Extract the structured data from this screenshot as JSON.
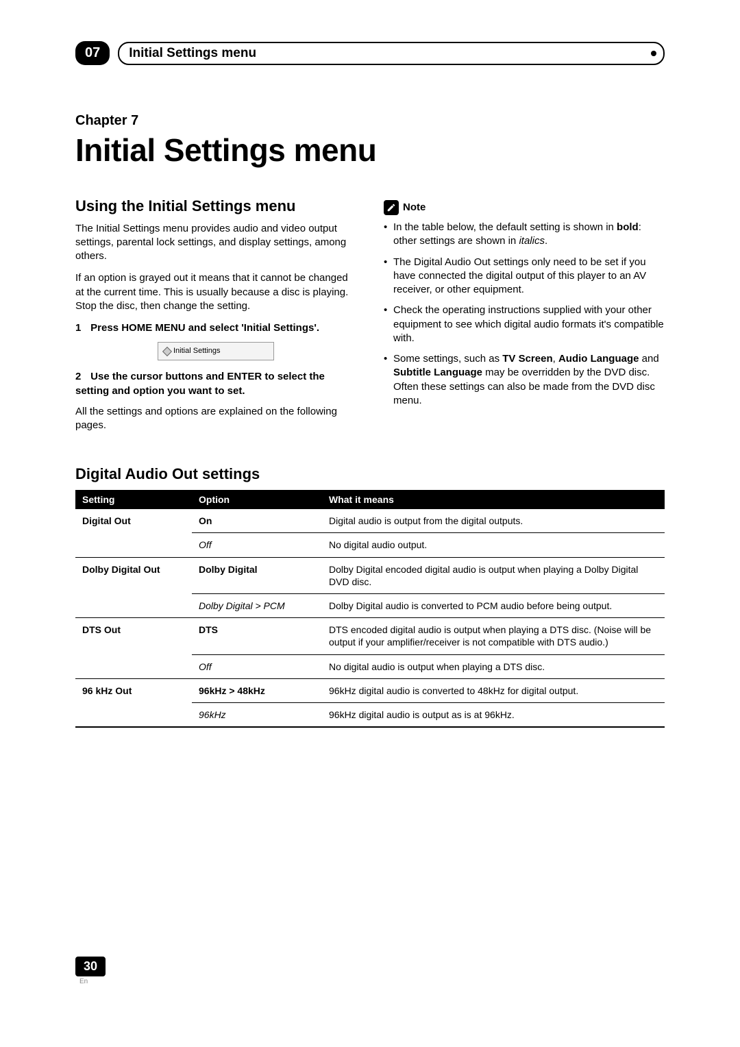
{
  "header": {
    "chapter_number_badge": "07",
    "section_title": "Initial Settings menu"
  },
  "chapter": {
    "label": "Chapter 7",
    "title": "Initial Settings menu"
  },
  "left": {
    "heading": "Using the Initial Settings menu",
    "p1": "The Initial Settings menu provides audio and video output settings, parental lock settings, and display settings, among others.",
    "p2": "If an option is grayed out it means that it cannot be changed at the current time. This is usually because a disc is playing. Stop the disc, then change the setting.",
    "step1_num": "1",
    "step1": "Press HOME MENU and select 'Initial Settings'.",
    "screenshot_label": "Initial Settings",
    "step2_num": "2",
    "step2": "Use the cursor buttons and ENTER to select the setting and option you want to set.",
    "p3": "All the settings and options are explained on the following pages."
  },
  "right": {
    "note_label": "Note",
    "bullets": {
      "b1_pre": "In the table below, the default setting is shown in ",
      "b1_bold": "bold",
      "b1_mid": ": other settings are shown in ",
      "b1_it": "italics",
      "b1_post": ".",
      "b2": "The Digital Audio Out settings only need to be set if you have connected the digital output of this player to an AV receiver, or other equipment.",
      "b3": "Check the operating instructions supplied with your other equipment to see which digital audio formats it's compatible with.",
      "b4_pre": "Some settings, such as ",
      "b4_b1": "TV Screen",
      "b4_sep1": ", ",
      "b4_b2": "Audio Language",
      "b4_sep2": " and ",
      "b4_b3": "Subtitle Language",
      "b4_post": " may be overridden by the DVD disc. Often these settings can also be made from the DVD disc menu."
    }
  },
  "table_section_heading": "Digital Audio Out settings",
  "table": {
    "headers": {
      "c1": "Setting",
      "c2": "Option",
      "c3": "What it means"
    },
    "rows": [
      {
        "setting": "Digital Out",
        "option": "On",
        "option_style": "default",
        "meaning": "Digital audio is output from the digital outputs."
      },
      {
        "setting": "",
        "option": "Off",
        "option_style": "italic",
        "meaning": "No digital audio output."
      },
      {
        "setting": "Dolby Digital Out",
        "option": "Dolby Digital",
        "option_style": "default",
        "meaning": "Dolby Digital encoded digital audio is output when playing a Dolby Digital DVD disc."
      },
      {
        "setting": "",
        "option": "Dolby Digital > PCM",
        "option_style": "italic",
        "meaning": "Dolby Digital audio is converted to PCM audio before being output."
      },
      {
        "setting": "DTS Out",
        "option": "DTS",
        "option_style": "default",
        "meaning": "DTS encoded digital audio is output when playing a DTS disc. (Noise will be output if your amplifier/receiver is not compatible with DTS audio.)"
      },
      {
        "setting": "",
        "option": "Off",
        "option_style": "italic",
        "meaning": "No digital audio is output when playing a DTS disc."
      },
      {
        "setting": "96 kHz Out",
        "option": "96kHz > 48kHz",
        "option_style": "default",
        "meaning": "96kHz digital audio is converted to 48kHz for digital output."
      },
      {
        "setting": "",
        "option": "96kHz",
        "option_style": "italic",
        "meaning": "96kHz digital audio is output as is at 96kHz."
      }
    ]
  },
  "footer": {
    "page_number": "30",
    "lang": "En"
  }
}
